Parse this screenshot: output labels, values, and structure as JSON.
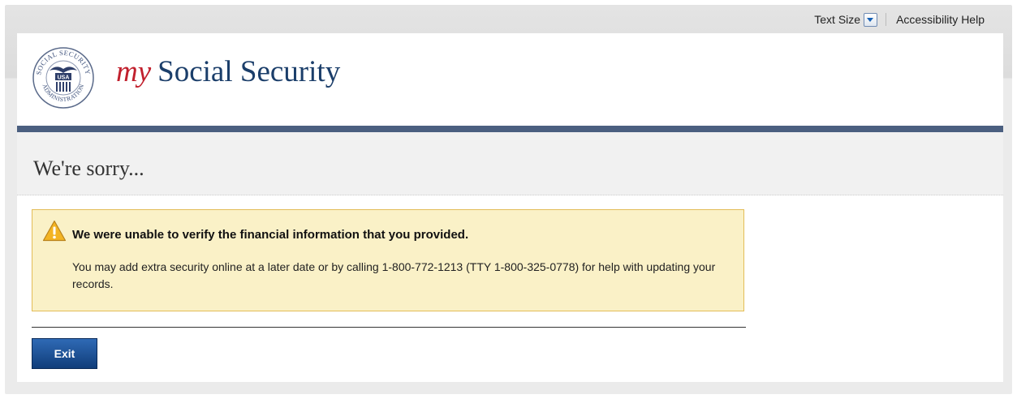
{
  "utility": {
    "text_size_label": "Text Size",
    "accessibility_help_label": "Accessibility Help"
  },
  "header": {
    "brand_my": "my",
    "brand_name": "Social Security",
    "logo_icon": "ssa-seal-icon",
    "logo_top_text": "SOCIAL SECURITY",
    "logo_bottom_text": "ADMINISTRATION",
    "logo_center_text": "USA"
  },
  "page": {
    "title": "We're sorry..."
  },
  "alert": {
    "icon": "warning-icon",
    "heading": "We were unable to verify the financial information that you provided.",
    "body": "You may add extra security online at a later date or by calling 1-800-772-1213 (TTY 1-800-325-0778) for help with updating your records."
  },
  "actions": {
    "exit_label": "Exit"
  },
  "colors": {
    "brand_red": "#c1202d",
    "brand_navy": "#1b3e6a",
    "header_rule": "#4b5f80",
    "alert_bg": "#faf1c7",
    "alert_border": "#e3bd58",
    "button_blue": "#103d7a"
  }
}
